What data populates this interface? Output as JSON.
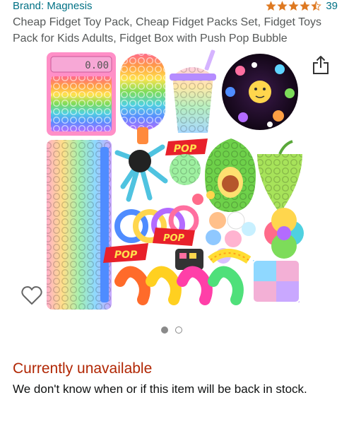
{
  "product": {
    "brand": "Brand: Magnesis",
    "rating_stars": 4.5,
    "review_count": "39",
    "title": "Cheap Fidget Toy Pack, Cheap Fidget Packs Set, Fidget Toys Pack for Kids Adults, Fidget Box with Push Pop Bubble"
  },
  "gallery": {
    "image_count": 2,
    "active_index": 0
  },
  "icons": {
    "share": "share-icon",
    "wishlist": "heart-icon",
    "star": "star-icon"
  },
  "availability": {
    "status": "Currently unavailable",
    "message": "We don't know when or if this item will be back in stock."
  },
  "colors": {
    "link": "#007185",
    "star": "#de7921",
    "unavailable": "#b12704"
  }
}
